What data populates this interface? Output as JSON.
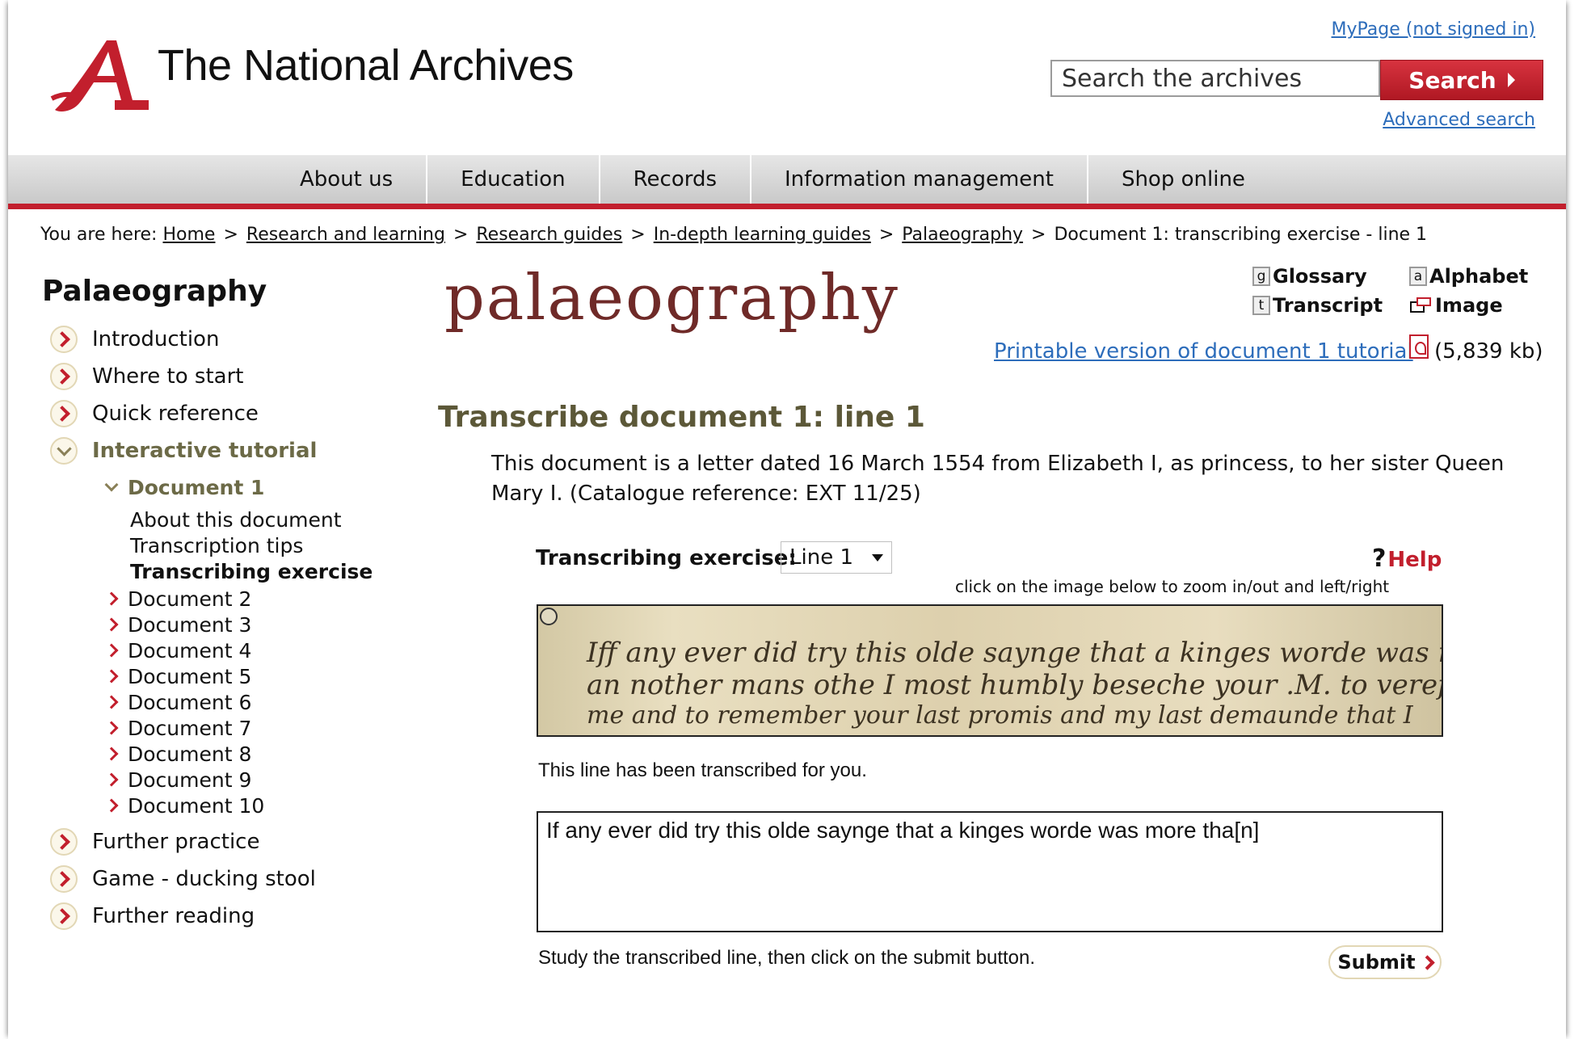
{
  "header": {
    "site_name": "The National Archives",
    "mypage_link": "MyPage (not signed in)",
    "search_placeholder": "Search the archives",
    "search_button": "Search",
    "advanced_search": "Advanced search"
  },
  "nav": {
    "items": [
      "About us",
      "Education",
      "Records",
      "Information management",
      "Shop online"
    ]
  },
  "breadcrumb": {
    "prefix": "You are here:",
    "links": [
      "Home",
      "Research and learning",
      "Research guides",
      "In-depth learning guides",
      "Palaeography"
    ],
    "current": "Document 1: transcribing exercise - line 1"
  },
  "sidebar": {
    "title": "Palaeography",
    "top_items": [
      "Introduction",
      "Where to start",
      "Quick reference"
    ],
    "active_item": "Interactive tutorial",
    "active_doc": "Document 1",
    "active_doc_sub": [
      "About this document",
      "Transcription tips",
      "Transcribing exercise"
    ],
    "other_docs": [
      "Document 2",
      "Document 3",
      "Document 4",
      "Document 5",
      "Document 6",
      "Document 7",
      "Document 8",
      "Document 9",
      "Document 10"
    ],
    "bottom_items": [
      "Further practice",
      "Game - ducking stool",
      "Further reading"
    ]
  },
  "main": {
    "logo_text": "palaeography",
    "tools": {
      "glossary_key": "g",
      "glossary": "Glossary",
      "alphabet_key": "a",
      "alphabet": "Alphabet",
      "transcript_key": "t",
      "transcript": "Transcript",
      "image": "Image"
    },
    "print_link": "Printable version of document 1 tutorial",
    "print_size": "(5,839 kb)",
    "heading": "Transcribe document 1: line 1",
    "intro": "This document is a letter dated 16 March 1554 from Elizabeth I, as princess, to her sister Queen Mary I. (Catalogue reference: EXT 11/25)",
    "exercise_label": "Transcribing exercise:",
    "exercise_selected": "Line 1",
    "help": "Help",
    "zoom_hint": "click on the image below to zoom in/out and left/right",
    "transcribed_note": "This line has been transcribed for you.",
    "transcript_text": "If any ever did try this olde saynge that a kinges worde was more tha[n]",
    "study_note": "Study the transcribed line, then click on the submit button.",
    "submit": "Submit"
  },
  "colors": {
    "brand_red": "#c21f2d",
    "link_blue": "#2d6dbb",
    "heading_olive": "#5c5838",
    "palaeo_brown": "#6f2a28"
  }
}
